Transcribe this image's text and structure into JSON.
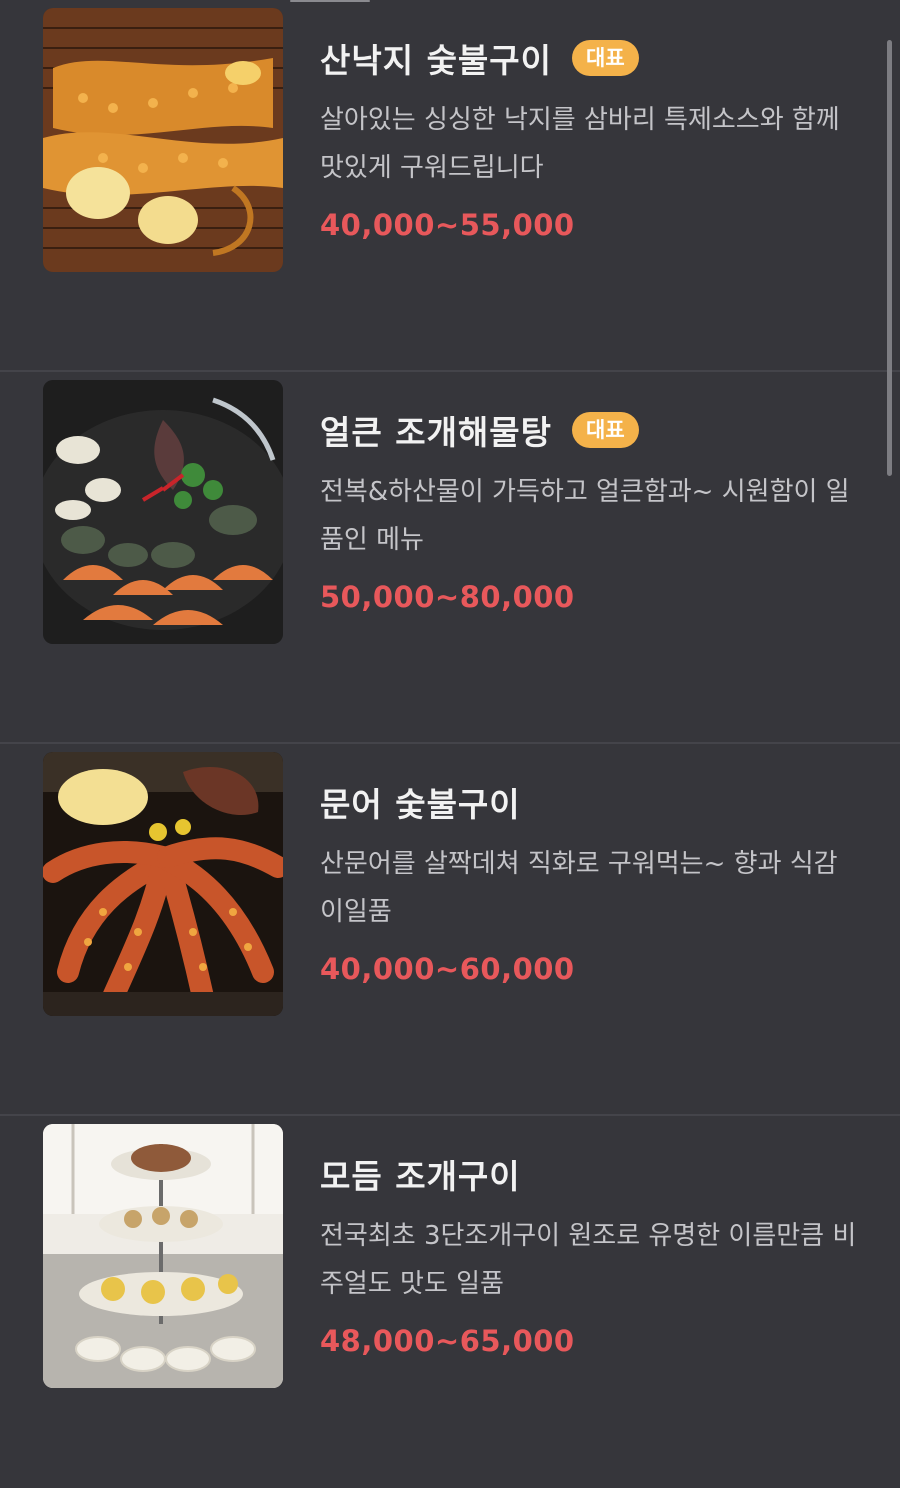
{
  "menu": {
    "items": [
      {
        "title": "산낙지 숯불구이",
        "badge": "대표",
        "description": "살아있는 싱싱한 낙지를 삼바리 특제소스와 함께 맛있게 구워드립니다",
        "price": "40,000~55,000",
        "image": "grilled-octopus-image"
      },
      {
        "title": "얼큰 조개해물탕",
        "badge": "대표",
        "description": "전복&하산물이 가득하고 얼큰함과~ 시원함이 일품인 메뉴",
        "price": "50,000~80,000",
        "image": "seafood-stew-image"
      },
      {
        "title": "문어 숯불구이",
        "badge": "",
        "description": "산문어를 살짝데쳐 직화로 구워먹는~ 향과 식감이일품",
        "price": "40,000~60,000",
        "image": "grilled-octopus-charcoal-image"
      },
      {
        "title": "모듬 조개구이",
        "badge": "",
        "description": "전국최초 3단조개구이 원조로 유명한 이름만큼 비주얼도 맛도 일품",
        "price": "48,000~65,000",
        "image": "shellfish-tower-image"
      }
    ]
  },
  "colors": {
    "background": "#36363b",
    "badge": "#f4b24a",
    "price": "#e8585b",
    "divider": "#44444a"
  }
}
